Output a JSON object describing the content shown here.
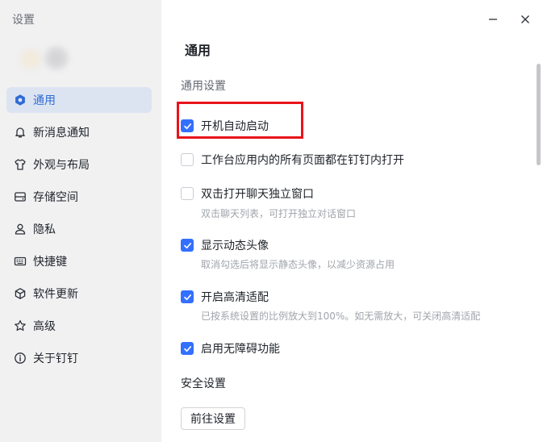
{
  "window": {
    "title": "设置"
  },
  "sidebar": {
    "items": [
      {
        "label": "通用",
        "icon": "gear-icon",
        "active": true
      },
      {
        "label": "新消息通知",
        "icon": "bell-icon",
        "active": false
      },
      {
        "label": "外观与布局",
        "icon": "shirt-icon",
        "active": false
      },
      {
        "label": "存储空间",
        "icon": "storage-icon",
        "active": false
      },
      {
        "label": "隐私",
        "icon": "user-icon",
        "active": false
      },
      {
        "label": "快捷键",
        "icon": "keyboard-icon",
        "active": false
      },
      {
        "label": "软件更新",
        "icon": "cube-icon",
        "active": false
      },
      {
        "label": "高级",
        "icon": "star-icon",
        "active": false
      },
      {
        "label": "关于钉钉",
        "icon": "info-icon",
        "active": false
      }
    ]
  },
  "main": {
    "title": "通用",
    "general_section": "通用设置",
    "options": [
      {
        "label": "开机自动启动",
        "checked": true,
        "hint": ""
      },
      {
        "label": "工作台应用内的所有页面都在钉钉内打开",
        "checked": false,
        "hint": ""
      },
      {
        "label": "双击打开聊天独立窗口",
        "checked": false,
        "hint": "双击聊天列表，可打开独立对话窗口"
      },
      {
        "label": "显示动态头像",
        "checked": true,
        "hint": "取消勾选后将显示静态头像，以减少资源占用"
      },
      {
        "label": "开启高清适配",
        "checked": true,
        "hint": "已按系统设置的比例放大到100%。如无需放大，可关闭高清适配"
      },
      {
        "label": "启用无障碍功能",
        "checked": true,
        "hint": ""
      }
    ],
    "security_section": "安全设置",
    "goto_button": "前往设置"
  },
  "colors": {
    "accent": "#3370ff",
    "sidebar_bg": "#f1f1f2",
    "active_item_bg": "#dde4f1",
    "active_item_text": "#2e6bd6",
    "highlight_red": "#e8141b"
  }
}
